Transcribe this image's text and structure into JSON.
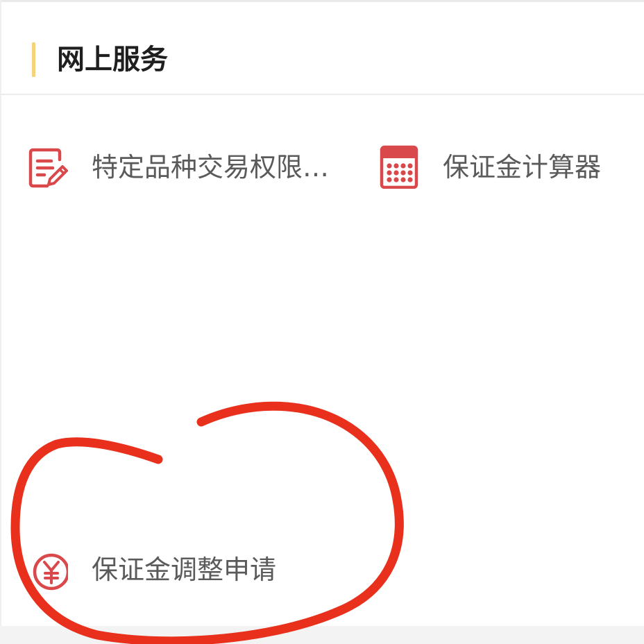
{
  "section": {
    "title": "网上服务"
  },
  "services": [
    {
      "label": "特定品种交易权限…",
      "icon": "edit-document-icon"
    },
    {
      "label": "保证金计算器",
      "icon": "calculator-icon"
    },
    {
      "label": "保证金调整申请",
      "icon": "yen-coin-icon"
    }
  ],
  "colors": {
    "accent": "#f5d27c",
    "icon_red": "#d9484a",
    "annotation_red": "#e8301c",
    "label_gray": "#5a5a5a",
    "title": "#1f1f1f"
  }
}
